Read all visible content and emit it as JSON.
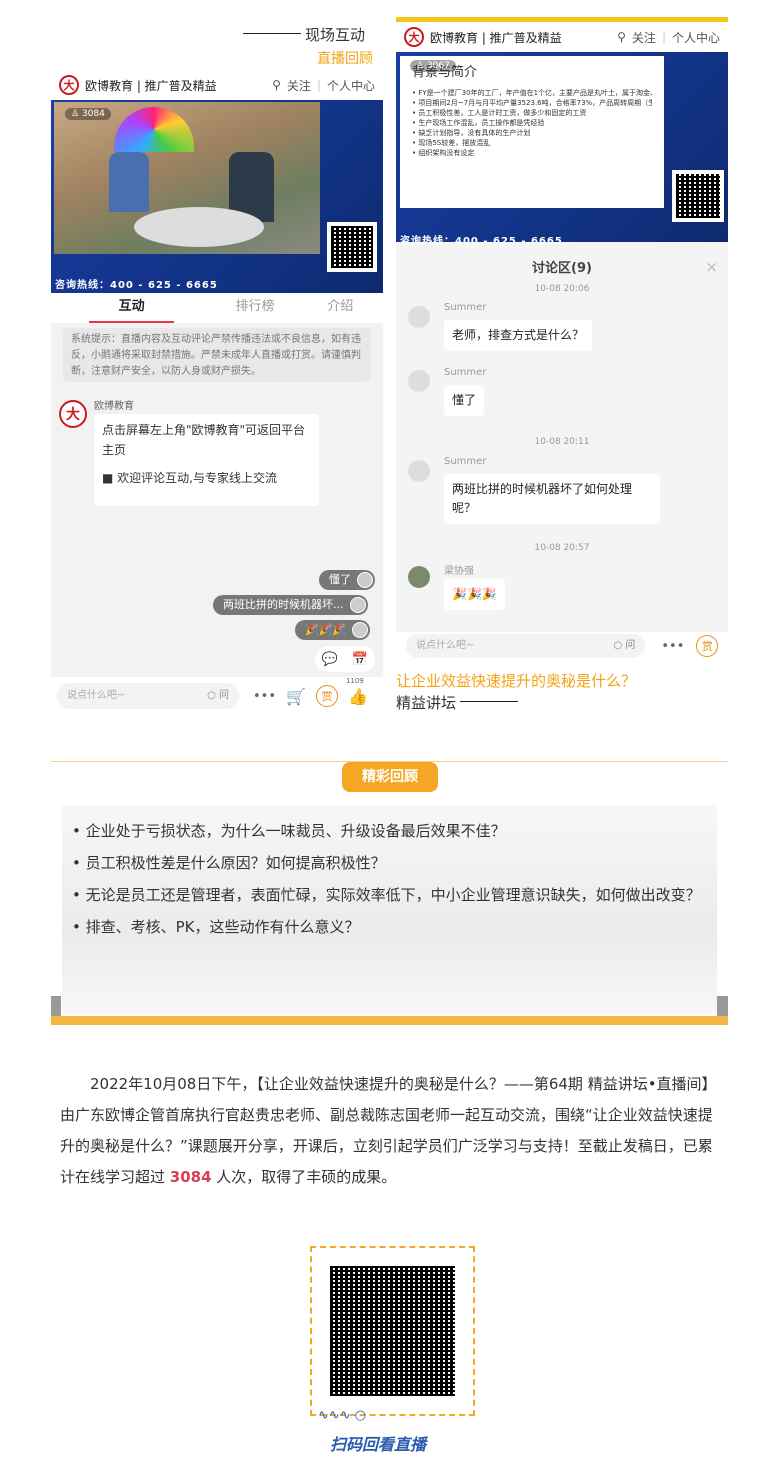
{
  "top_left_caption": "现场互动",
  "top_left_sub": "直播回顾",
  "right_caption": "让企业效益快速提升的奥秘是什么？",
  "right_caption2": "精益讲坛",
  "header": {
    "title": "欧博教育 | 推广普及精益",
    "follow": "关注",
    "center": "个人中心",
    "logo": "大"
  },
  "left_phone": {
    "viewers": "3084",
    "hotline": "咨询热线：400 - 625 - 6665",
    "tabs": [
      "互动",
      "排行榜",
      "介绍"
    ],
    "notice": "系统提示：直播内容及互动评论严禁传播违法或不良信息，如有违反，小鹅通将采取封禁措施。严禁未成年人直播或打赏。请谨慎判断，注意财产安全，以防人身或财产损失。",
    "sender": "欧博教育",
    "msg1": "点击屏幕左上角\"欧博教育\"可返回平台主页",
    "msg2": "■ 欢迎评论互动,与专家线上交流",
    "pill1": "懂了",
    "pill2": "两班比拼的时候机器坏...",
    "pill3": "🎉🎉🎉",
    "input_placeholder": "说点什么吧~",
    "ask": "问",
    "reward": "赏",
    "likes": "1109"
  },
  "right_phone": {
    "viewers": "3067",
    "slide_title": "背景与简介",
    "slide_lines": [
      "FY是一个建厂30年的工厂，年产值在1个亿，主要产品是丸叶土，属于淘金、采用金原料",
      "项目期间2月~7月与月平均产量3523.6吨，合格率73%，产品周转周期（生产时间+成品库存周转时长）17天",
      "员工积极性差，工人是计时工资，做多少和固定的工资",
      "生产现场工作混乱，员工操作都是凭经验",
      "缺乏计划指导，没有具体的生产计划",
      "现场5S较差，摆放混乱",
      "组织架构没有设定"
    ],
    "hotline": "咨询热线：400 - 625 - 6665",
    "discussion_title": "讨论区(9)",
    "close": "×",
    "items": [
      {
        "time": "10-08 20:06",
        "name": "Summer",
        "text": "老师，排查方式是什么？"
      },
      {
        "time": "",
        "name": "Summer",
        "text": "懂了"
      },
      {
        "time": "10-08 20:11",
        "name": "Summer",
        "text": "两班比拼的时候机器坏了如何处理呢？"
      },
      {
        "time": "10-08 20:57",
        "name": "梁协强",
        "text": "🎉🎉🎉"
      }
    ],
    "input_placeholder": "说点什么吧~",
    "ask": "问",
    "reward": "赏"
  },
  "review_banner": "精彩回顾",
  "qa": [
    "• 企业处于亏损状态，为什么一味裁员、升级设备最后效果不佳？",
    "• 员工积极性差是什么原因？如何提高积极性？",
    "• 无论是员工还是管理者，表面忙碌，实际效率低下，中小企业管理意识缺失，如何做出改变？",
    "• 排查、考核、PK，这些动作有什么意义？"
  ],
  "paragraph_a": "2022年10月08日下午，【让企业效益快速提升的奥秘是什么？——第64期 精益讲坛•直播间】由广东欧博企管首席执行官赵贵忠老师、副总裁陈志国老师一起互动交流，围绕“让企业效益快速提升的奥秘是什么？”课题展开分享，开课后，立刻引起学员们广泛学习与支持！至截止发稿日，已累计在线学习超过 ",
  "paragraph_num": "3084",
  "paragraph_b": " 人次，取得了丰硕的成果。",
  "qr_caption": "扫码回看直播",
  "colors": {
    "accent": "#f5a623",
    "brand_red": "#c91c1c",
    "highlight": "#d73f53"
  }
}
